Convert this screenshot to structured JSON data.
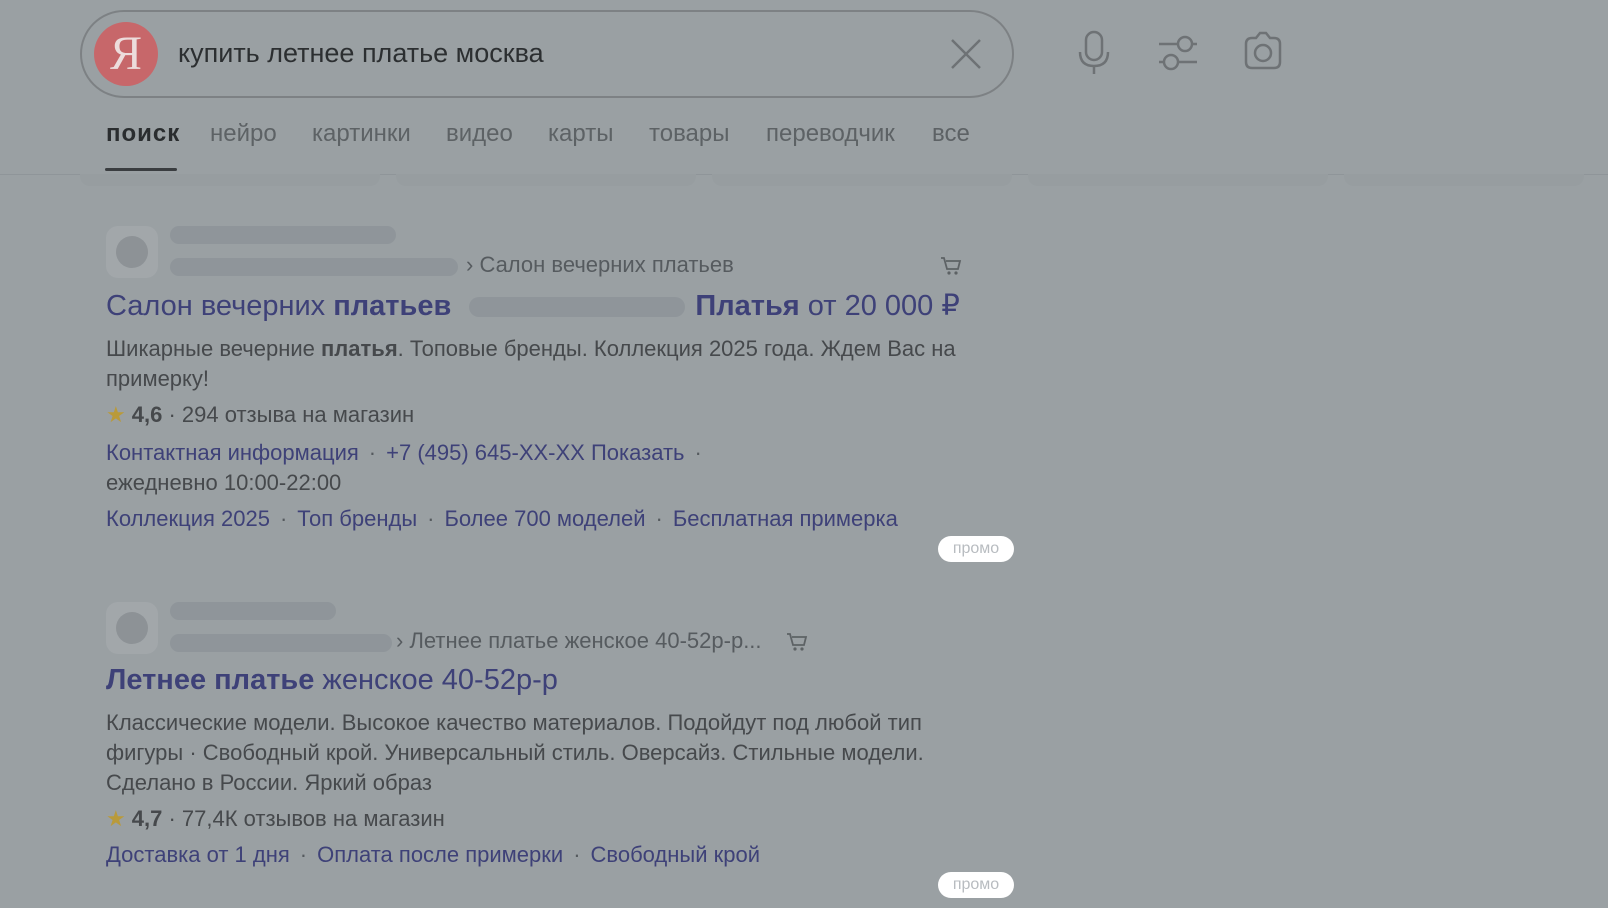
{
  "search": {
    "logo_letter": "Я",
    "query": "купить летнее платье москва"
  },
  "tabs": [
    "поиск",
    "нейро",
    "картинки",
    "видео",
    "карты",
    "товары",
    "переводчик",
    "все"
  ],
  "results": [
    {
      "breadcrumb": "› Салон вечерних платьев",
      "title_a": "Салон вечерних ",
      "title_b": "платьев",
      "title_c": "Платья",
      "title_d": " от 20 000 ₽",
      "desc_a": "Шикарные вечерние ",
      "desc_b": "платья",
      "desc_c": ". Топовые бренды. Коллекция 2025 года. Ждем Вас на примерку!",
      "rating": "4,6",
      "reviews": "· 294 отзыва на магазин",
      "contact_link": "Контактная информация",
      "phone_link": "+7 (495) 645-ХХ-ХХ Показать",
      "hours": "ежедневно 10:00-22:00",
      "sitelinks": [
        "Коллекция 2025",
        "Топ бренды",
        "Более 700 моделей",
        "Бесплатная примерка"
      ],
      "badge": "промо"
    },
    {
      "breadcrumb": "› Летнее платье женское 40-52р-р...",
      "title_a": "Летнее платье",
      "title_b": " женское 40-52р-р",
      "desc": "Классические модели. Высокое качество материалов. Подойдут под любой тип фигуры · Свободный крой. Универсальный стиль. Оверсайз. Стильные модели. Сделано в России. Яркий образ",
      "rating": "4,7",
      "reviews": "· 77,4К отзывов на магазин",
      "sitelinks": [
        "Доставка от 1 дня",
        "Оплата после примерки",
        "Свободный крой"
      ],
      "badge": "промо"
    }
  ]
}
